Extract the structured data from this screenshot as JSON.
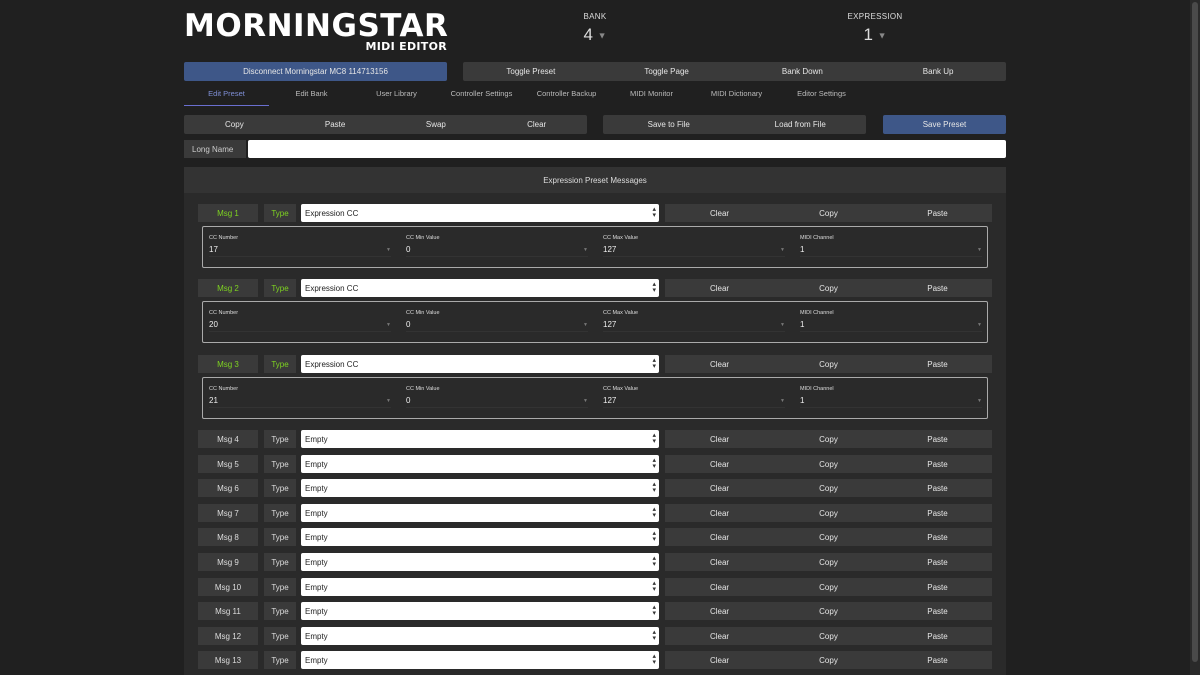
{
  "logo": {
    "title": "MORNINGSTAR",
    "subtitle": "MIDI EDITOR"
  },
  "bank": {
    "label": "BANK",
    "value": "4"
  },
  "expression": {
    "label": "EXPRESSION",
    "value": "1"
  },
  "connection": {
    "label": "Disconnect Morningstar MC8 114713156"
  },
  "nav_buttons": [
    "Toggle Preset",
    "Toggle Page",
    "Bank Down",
    "Bank Up"
  ],
  "tabs": [
    "Edit Preset",
    "Edit Bank",
    "User Library",
    "Controller Settings",
    "Controller Backup",
    "MIDI Monitor",
    "MIDI Dictionary",
    "Editor Settings"
  ],
  "edit_buttons": [
    "Copy",
    "Paste",
    "Swap",
    "Clear"
  ],
  "file_buttons": [
    "Save to File",
    "Load from File"
  ],
  "save_preset": "Save Preset",
  "long_name": {
    "label": "Long Name",
    "value": ""
  },
  "panel_title": "Expression Preset Messages",
  "type_label": "Type",
  "row_actions": [
    "Clear",
    "Copy",
    "Paste"
  ],
  "messages": [
    {
      "label": "Msg 1",
      "type": "Expression CC",
      "fields": [
        {
          "l": "CC Number",
          "v": "17"
        },
        {
          "l": "CC Min Value",
          "v": "0"
        },
        {
          "l": "CC Max Value",
          "v": "127"
        },
        {
          "l": "MIDI Channel",
          "v": "1"
        }
      ]
    },
    {
      "label": "Msg 2",
      "type": "Expression CC",
      "fields": [
        {
          "l": "CC Number",
          "v": "20"
        },
        {
          "l": "CC Min Value",
          "v": "0"
        },
        {
          "l": "CC Max Value",
          "v": "127"
        },
        {
          "l": "MIDI Channel",
          "v": "1"
        }
      ]
    },
    {
      "label": "Msg 3",
      "type": "Expression CC",
      "fields": [
        {
          "l": "CC Number",
          "v": "21"
        },
        {
          "l": "CC Min Value",
          "v": "0"
        },
        {
          "l": "CC Max Value",
          "v": "127"
        },
        {
          "l": "MIDI Channel",
          "v": "1"
        }
      ]
    },
    {
      "label": "Msg 4",
      "type": "Empty"
    },
    {
      "label": "Msg 5",
      "type": "Empty"
    },
    {
      "label": "Msg 6",
      "type": "Empty"
    },
    {
      "label": "Msg 7",
      "type": "Empty"
    },
    {
      "label": "Msg 8",
      "type": "Empty"
    },
    {
      "label": "Msg 9",
      "type": "Empty"
    },
    {
      "label": "Msg 10",
      "type": "Empty"
    },
    {
      "label": "Msg 11",
      "type": "Empty"
    },
    {
      "label": "Msg 12",
      "type": "Empty"
    },
    {
      "label": "Msg 13",
      "type": "Empty"
    }
  ],
  "colors": {
    "accent_blue": "#3e5788",
    "active_green": "#7ed321",
    "active_tab": "#7f8fd6"
  }
}
